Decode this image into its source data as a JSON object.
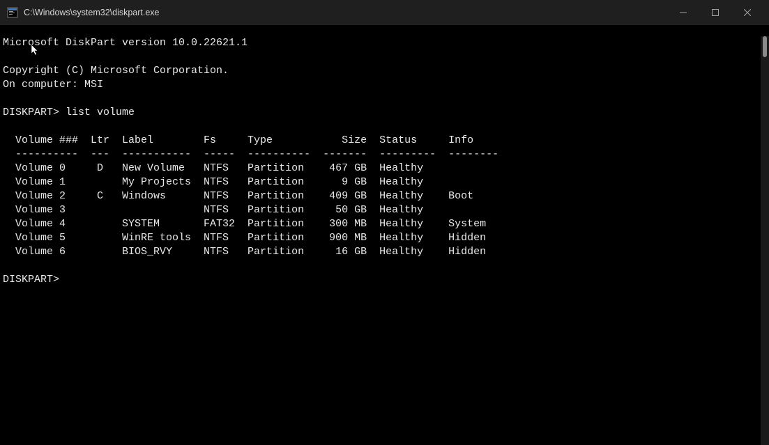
{
  "titlebar": {
    "title": "C:\\Windows\\system32\\diskpart.exe"
  },
  "header": {
    "version": "Microsoft DiskPart version 10.0.22621.1",
    "copyright": "Copyright (C) Microsoft Corporation.",
    "computer": "On computer: MSI"
  },
  "prompt1": "DISKPART> ",
  "command1": "list volume",
  "prompt2": "DISKPART>",
  "table": {
    "headers": {
      "vol": "Volume ###",
      "ltr": "Ltr",
      "label": "Label",
      "fs": "Fs",
      "type": "Type",
      "size": "Size",
      "status": "Status",
      "info": "Info"
    },
    "separator": {
      "vol": "----------",
      "ltr": "---",
      "label": "-----------",
      "fs": "-----",
      "type": "----------",
      "size": "-------",
      "status": "---------",
      "info": "--------"
    },
    "rows": [
      {
        "vol": "Volume 0",
        "ltr": "D",
        "label": "New Volume",
        "fs": "NTFS",
        "type": "Partition",
        "size": "467 GB",
        "status": "Healthy",
        "info": ""
      },
      {
        "vol": "Volume 1",
        "ltr": "",
        "label": "My Projects",
        "fs": "NTFS",
        "type": "Partition",
        "size": "9 GB",
        "status": "Healthy",
        "info": ""
      },
      {
        "vol": "Volume 2",
        "ltr": "C",
        "label": "Windows",
        "fs": "NTFS",
        "type": "Partition",
        "size": "409 GB",
        "status": "Healthy",
        "info": "Boot"
      },
      {
        "vol": "Volume 3",
        "ltr": "",
        "label": "",
        "fs": "NTFS",
        "type": "Partition",
        "size": "50 GB",
        "status": "Healthy",
        "info": ""
      },
      {
        "vol": "Volume 4",
        "ltr": "",
        "label": "SYSTEM",
        "fs": "FAT32",
        "type": "Partition",
        "size": "300 MB",
        "status": "Healthy",
        "info": "System"
      },
      {
        "vol": "Volume 5",
        "ltr": "",
        "label": "WinRE tools",
        "fs": "NTFS",
        "type": "Partition",
        "size": "900 MB",
        "status": "Healthy",
        "info": "Hidden"
      },
      {
        "vol": "Volume 6",
        "ltr": "",
        "label": "BIOS_RVY",
        "fs": "NTFS",
        "type": "Partition",
        "size": "16 GB",
        "status": "Healthy",
        "info": "Hidden"
      }
    ]
  }
}
